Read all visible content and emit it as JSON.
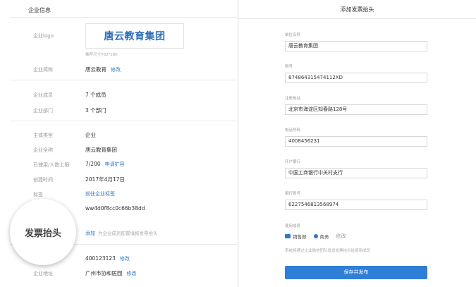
{
  "left": {
    "section_title": "企业信息",
    "logo_label": "企业logo",
    "logo_text": "唐云教育集团",
    "logo_hint": "推荐尺寸702*180",
    "short_name_label": "企业简称",
    "short_name_value": "唐云教育",
    "short_name_edit": "修改",
    "members_label": "企业成员",
    "members_value": "7 个成员",
    "departments_label": "企业部门",
    "departments_value": "3 个部门",
    "subject_type_label": "主体类型",
    "subject_type_value": "企业",
    "full_name_label": "企业全称",
    "full_name_value": "唐云教育集团",
    "usage_label": "已使用/人数上限",
    "usage_value": "7/200",
    "usage_link": "申请扩容",
    "created_label": "创建时间",
    "created_value": "2017年4月17日",
    "tags_label": "标签",
    "tags_link": "前往企业标签",
    "corp_id_value": "ww4d0f8cc0c66b38dd",
    "invoice_magnified": "发票抬头",
    "invoice_add": "添加",
    "invoice_hint": "为企业成员配置填报发票抬头",
    "phone_value": "400123123",
    "phone_edit": "修改",
    "address_label": "企业地址",
    "address_value": "广州市协和医园",
    "address_edit": "修改"
  },
  "modal": {
    "title": "添加发票抬头",
    "fields": [
      {
        "label": "单位名称",
        "value": "唐云教育集团"
      },
      {
        "label": "税号",
        "value": "874864315474112XD"
      },
      {
        "label": "注册地址",
        "value": "北京市海淀区知春路128号"
      },
      {
        "label": "电话号码",
        "value": "4008456231"
      },
      {
        "label": "开户银行",
        "value": "中国工商银行中关村支行"
      },
      {
        "label": "银行账号",
        "value": "6227546813568974"
      }
    ],
    "scope_label": "使用成员",
    "scope_items": [
      "销售部",
      "商务"
    ],
    "scope_edit": "修改",
    "note": "系统将通过企业微信团队发送发票抬头给使用成员",
    "save_label": "保存并发布"
  },
  "colors": {
    "accent": "#2f7ed8",
    "link": "#2d78c8"
  }
}
